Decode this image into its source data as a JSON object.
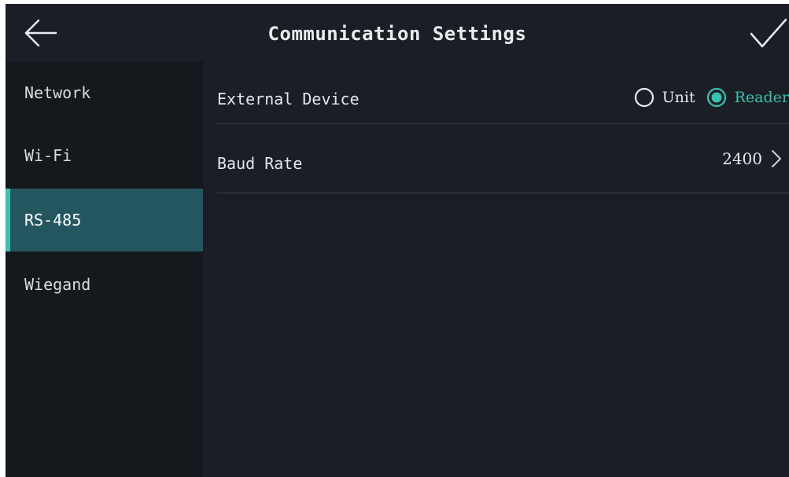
{
  "header": {
    "title": "Communication Settings",
    "back_icon": "arrow-left-icon",
    "confirm_icon": "checkmark-icon"
  },
  "sidebar": {
    "items": [
      {
        "label": "Network",
        "active": false
      },
      {
        "label": "Wi-Fi",
        "active": false
      },
      {
        "label": "RS-485",
        "active": true
      },
      {
        "label": "Wiegand",
        "active": false
      }
    ]
  },
  "settings": {
    "external_device": {
      "label": "External Device",
      "options": [
        {
          "label": "Unit",
          "selected": false
        },
        {
          "label": "Reader",
          "selected": true
        }
      ]
    },
    "baud_rate": {
      "label": "Baud Rate",
      "value": "2400"
    }
  },
  "colors": {
    "accent": "#35c3b1",
    "active_bg": "#245660",
    "sidebar_bg": "#15191e",
    "content_bg": "#1b1f25",
    "divider": "#3a3f46"
  }
}
